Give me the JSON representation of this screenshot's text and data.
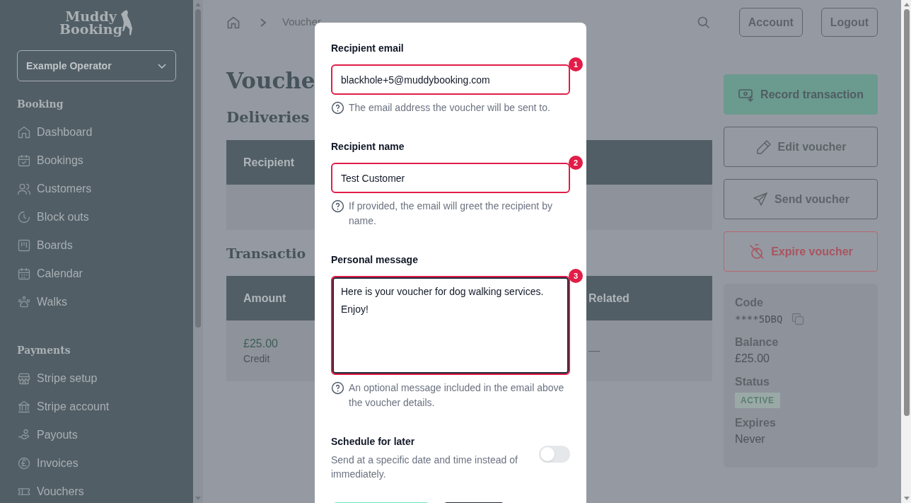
{
  "sidebar": {
    "logo": {
      "line1": "Muddy",
      "line2": "Booking"
    },
    "operator_select": {
      "value": "Example Operator"
    },
    "sections": [
      {
        "heading": "Booking",
        "items": [
          {
            "label": "Dashboard"
          },
          {
            "label": "Bookings"
          },
          {
            "label": "Customers"
          },
          {
            "label": "Block outs"
          },
          {
            "label": "Boards"
          },
          {
            "label": "Calendar"
          },
          {
            "label": "Walks"
          }
        ]
      },
      {
        "heading": "Payments",
        "items": [
          {
            "label": "Stripe setup"
          },
          {
            "label": "Stripe account"
          },
          {
            "label": "Payouts"
          },
          {
            "label": "Invoices"
          },
          {
            "label": "Vouchers"
          }
        ]
      }
    ]
  },
  "header": {
    "breadcrumb": [
      "Voucher"
    ],
    "buttons": [
      "Account",
      "Logout"
    ]
  },
  "page": {
    "title": "Vouche",
    "deliveries": {
      "heading": "Deliveries",
      "columns": [
        "Recipient"
      ]
    },
    "transactions": {
      "heading": "Transactio",
      "columns": [
        "Amount",
        "Related"
      ],
      "rows": [
        {
          "amount": "£25.00",
          "type": "Credit",
          "related": "—"
        }
      ]
    }
  },
  "actions": [
    {
      "label": "Record transaction",
      "kind": "primary"
    },
    {
      "label": "Edit voucher",
      "kind": "outline"
    },
    {
      "label": "Send voucher",
      "kind": "outline"
    },
    {
      "label": "Expire voucher",
      "kind": "danger"
    }
  ],
  "details": [
    {
      "label": "Code",
      "value": "****5DBQ",
      "kind": "code"
    },
    {
      "label": "Balance",
      "value": "£25.00",
      "kind": "text"
    },
    {
      "label": "Status",
      "value": "ACTIVE",
      "kind": "badge"
    },
    {
      "label": "Expires",
      "value": "Never",
      "kind": "text"
    }
  ],
  "modal": {
    "fields": [
      {
        "label": "Recipient email",
        "value": "blackhole+5@muddybooking.com",
        "help": "The email address the voucher will be sent to.",
        "step": "1",
        "kind": "input",
        "focused": false
      },
      {
        "label": "Recipient name",
        "value": "Test Customer",
        "help": "If provided, the email will greet the recipient by name.",
        "step": "2",
        "kind": "input",
        "focused": false
      },
      {
        "label": "Personal message",
        "value": "Here is your voucher for dog walking services. Enjoy!",
        "help": "An optional message included in the email above the voucher details.",
        "step": "3",
        "kind": "textarea",
        "focused": true
      }
    ],
    "schedule": {
      "label": "Schedule for later",
      "help": "Send at a specific date and time instead of immediately.",
      "on": false
    },
    "buttons": [
      {
        "kind": "primary"
      },
      {
        "kind": "secondary"
      }
    ]
  }
}
